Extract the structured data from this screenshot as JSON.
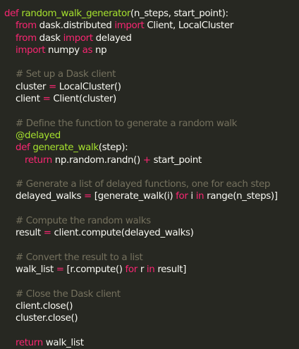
{
  "code": {
    "lines": [
      [
        {
          "t": "def ",
          "c": "kw"
        },
        {
          "t": "random_walk_generator",
          "c": "fn"
        },
        {
          "t": "(n_steps, start_point):",
          "c": "tx"
        }
      ],
      [
        {
          "t": "from ",
          "c": "kw"
        },
        {
          "t": "dask.distributed ",
          "c": "tx"
        },
        {
          "t": "import ",
          "c": "kw"
        },
        {
          "t": "Client, LocalCluster",
          "c": "tx"
        }
      ],
      [
        {
          "t": "from ",
          "c": "kw"
        },
        {
          "t": "dask ",
          "c": "tx"
        },
        {
          "t": "import ",
          "c": "kw"
        },
        {
          "t": "delayed",
          "c": "tx"
        }
      ],
      [
        {
          "t": "import ",
          "c": "kw"
        },
        {
          "t": "numpy ",
          "c": "tx"
        },
        {
          "t": "as ",
          "c": "kw"
        },
        {
          "t": "np",
          "c": "tx"
        }
      ],
      [],
      [
        {
          "t": "# Set up a Dask client",
          "c": "cm"
        }
      ],
      [
        {
          "t": "cluster ",
          "c": "tx"
        },
        {
          "t": "= ",
          "c": "kw"
        },
        {
          "t": "LocalCluster()",
          "c": "tx"
        }
      ],
      [
        {
          "t": "client ",
          "c": "tx"
        },
        {
          "t": "= ",
          "c": "kw"
        },
        {
          "t": "Client(cluster)",
          "c": "tx"
        }
      ],
      [],
      [
        {
          "t": "# Define the function to generate a random walk",
          "c": "cm"
        }
      ],
      [
        {
          "t": "@delayed",
          "c": "fn"
        }
      ],
      [
        {
          "t": "def ",
          "c": "kw"
        },
        {
          "t": "generate_walk",
          "c": "fn"
        },
        {
          "t": "(step):",
          "c": "tx"
        }
      ],
      [
        {
          "t": "return ",
          "c": "kw"
        },
        {
          "t": "np.random.randn() ",
          "c": "tx"
        },
        {
          "t": "+ ",
          "c": "kw"
        },
        {
          "t": "start_point",
          "c": "tx"
        }
      ],
      [],
      [
        {
          "t": "# Generate a list of delayed functions, one for each step",
          "c": "cm"
        }
      ],
      [
        {
          "t": "delayed_walks ",
          "c": "tx"
        },
        {
          "t": "= ",
          "c": "kw"
        },
        {
          "t": "[generate_walk(i) ",
          "c": "tx"
        },
        {
          "t": "for ",
          "c": "kw"
        },
        {
          "t": "i ",
          "c": "tx"
        },
        {
          "t": "in ",
          "c": "kw"
        },
        {
          "t": "range(n_steps)]",
          "c": "tx"
        }
      ],
      [],
      [
        {
          "t": "# Compute the random walks",
          "c": "cm"
        }
      ],
      [
        {
          "t": "result ",
          "c": "tx"
        },
        {
          "t": "= ",
          "c": "kw"
        },
        {
          "t": "client.compute(delayed_walks)",
          "c": "tx"
        }
      ],
      [],
      [
        {
          "t": "# Convert the result to a list",
          "c": "cm"
        }
      ],
      [
        {
          "t": "walk_list ",
          "c": "tx"
        },
        {
          "t": "= ",
          "c": "kw"
        },
        {
          "t": "[r.compute() ",
          "c": "tx"
        },
        {
          "t": "for ",
          "c": "kw"
        },
        {
          "t": "r ",
          "c": "tx"
        },
        {
          "t": "in ",
          "c": "kw"
        },
        {
          "t": "result]",
          "c": "tx"
        }
      ],
      [],
      [
        {
          "t": "# Close the Dask client",
          "c": "cm"
        }
      ],
      [
        {
          "t": "client.close()",
          "c": "tx"
        }
      ],
      [
        {
          "t": "cluster.close()",
          "c": "tx"
        }
      ],
      [],
      [
        {
          "t": "return ",
          "c": "kw"
        },
        {
          "t": "walk_list",
          "c": "tx"
        }
      ]
    ]
  },
  "colors": {
    "background": "#272822",
    "keyword": "#f92672",
    "function": "#a6e22e",
    "comment": "#75715e",
    "text": "#f8f8f2"
  }
}
